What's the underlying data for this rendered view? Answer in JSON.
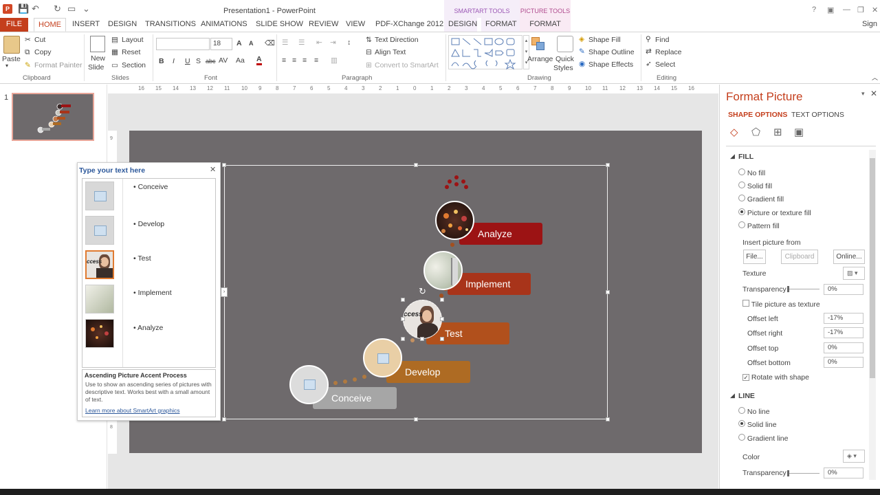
{
  "window": {
    "title": "Presentation1 - PowerPoint",
    "context_smartart": "SMARTART TOOLS",
    "context_picture": "PICTURE TOOLS",
    "help": "?",
    "sign_in": "Sign i"
  },
  "tabs": {
    "file": "FILE",
    "home": "HOME",
    "insert": "INSERT",
    "design": "DESIGN",
    "transitions": "TRANSITIONS",
    "animations": "ANIMATIONS",
    "slideshow": "SLIDE SHOW",
    "review": "REVIEW",
    "view": "VIEW",
    "pdfx": "PDF-XChange 2012",
    "sa_design": "DESIGN",
    "sa_format": "FORMAT",
    "pic_format": "FORMAT"
  },
  "ribbon": {
    "paste": "Paste",
    "cut": "Cut",
    "copy": "Copy",
    "format_painter": "Format Painter",
    "clipboard": "Clipboard",
    "new_slide_1": "New",
    "new_slide_2": "Slide",
    "layout": "Layout",
    "reset": "Reset",
    "section": "Section",
    "slides": "Slides",
    "font_name": "",
    "font_size": "18",
    "font": "Font",
    "text_direction": "Text Direction",
    "align_text": "Align Text",
    "convert_smartart": "Convert to SmartArt",
    "paragraph": "Paragraph",
    "arrange": "Arrange",
    "quick_1": "Quick",
    "quick_2": "Styles",
    "shape_fill": "Shape Fill",
    "shape_outline": "Shape Outline",
    "shape_effects": "Shape Effects",
    "drawing": "Drawing",
    "find": "Find",
    "replace": "Replace",
    "select": "Select",
    "editing": "Editing",
    "bold": "B",
    "italic": "I",
    "underline": "U",
    "shadow": "S",
    "strike": "abc"
  },
  "thumbnail": {
    "number": "1"
  },
  "ruler": {
    "h_ticks": [
      "16",
      "15",
      "14",
      "13",
      "12",
      "11",
      "10",
      "9",
      "8",
      "7",
      "6",
      "5",
      "4",
      "3",
      "2",
      "1",
      "0",
      "1",
      "2",
      "3",
      "4",
      "5",
      "6",
      "7",
      "8",
      "9",
      "10",
      "11",
      "12",
      "13",
      "14",
      "15",
      "16"
    ],
    "v_ticks": [
      "9",
      "8"
    ]
  },
  "smartart": {
    "steps": [
      {
        "label": "Conceive",
        "color": "#a6a6a6"
      },
      {
        "label": "Develop",
        "color": "#ae6b23"
      },
      {
        "label": "Test",
        "color": "#b1501c"
      },
      {
        "label": "Implement",
        "color": "#a8341a"
      },
      {
        "label": "Analyze",
        "color": "#9c1314"
      }
    ],
    "test_photo_text": "ccess"
  },
  "textpane": {
    "title": "Type your text here",
    "bullets": [
      "Conceive",
      "Develop",
      "Test",
      "Implement",
      "Analyze"
    ],
    "thumb_text": "ccess",
    "desc_title": "Ascending Picture Accent Process",
    "desc_body": "Use to show an ascending series of pictures with descriptive text. Works best with a small amount of text.",
    "learn_more": "Learn more about SmartArt graphics"
  },
  "format_pane": {
    "title": "Format Picture",
    "tab_shape": "SHAPE OPTIONS",
    "tab_text": "TEXT OPTIONS",
    "fill_header": "FILL",
    "fill_options": [
      {
        "label": "No fill",
        "selected": false
      },
      {
        "label": "Solid fill",
        "selected": false
      },
      {
        "label": "Gradient fill",
        "selected": false
      },
      {
        "label": "Picture or texture fill",
        "selected": true
      },
      {
        "label": "Pattern fill",
        "selected": false
      }
    ],
    "insert_from": "Insert picture from",
    "btn_file": "File...",
    "btn_clipboard": "Clipboard",
    "btn_online": "Online...",
    "texture": "Texture",
    "transparency": "Transparency",
    "transparency_value": "0%",
    "tile": "Tile picture as texture",
    "offset_left": "Offset left",
    "offset_left_value": "-17%",
    "offset_right": "Offset right",
    "offset_right_value": "-17%",
    "offset_top": "Offset top",
    "offset_top_value": "0%",
    "offset_bottom": "Offset bottom",
    "offset_bottom_value": "0%",
    "rotate": "Rotate with shape",
    "line_header": "LINE",
    "line_options": [
      {
        "label": "No line",
        "selected": false
      },
      {
        "label": "Solid line",
        "selected": true
      },
      {
        "label": "Gradient line",
        "selected": false
      }
    ],
    "color": "Color",
    "line_transparency": "Transparency",
    "line_transparency_value": "0%"
  }
}
